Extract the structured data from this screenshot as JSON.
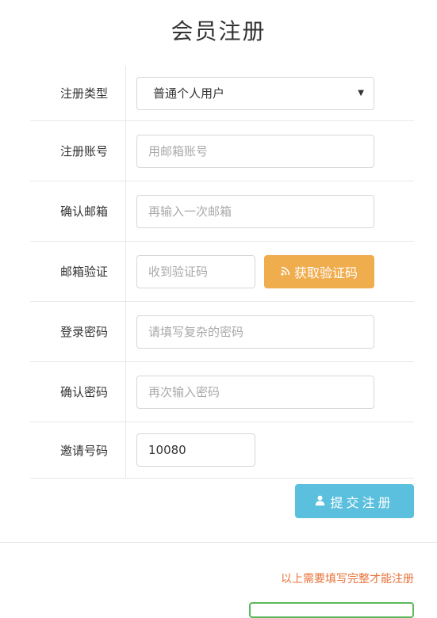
{
  "page": {
    "title": "会员注册"
  },
  "form": {
    "rows": [
      {
        "label": "注册类型",
        "type": "select",
        "value": "普通个人用户"
      },
      {
        "label": "注册账号",
        "type": "input",
        "placeholder": "用邮箱账号",
        "value": ""
      },
      {
        "label": "确认邮箱",
        "type": "input",
        "placeholder": "再输入一次邮箱",
        "value": ""
      },
      {
        "label": "邮箱验证",
        "type": "input",
        "placeholder": "收到验证码",
        "value": ""
      },
      {
        "label": "登录密码",
        "type": "input",
        "placeholder": "请填写复杂的密码",
        "value": ""
      },
      {
        "label": "确认密码",
        "type": "input",
        "placeholder": "再次输入密码",
        "value": ""
      },
      {
        "label": "邀请号码",
        "type": "input",
        "placeholder": "",
        "value": "10080"
      }
    ],
    "get_code_button": {
      "label": "获取验证码",
      "icon": "rss-icon"
    },
    "submit_button": {
      "label": "提交注册",
      "icon": "user-icon"
    }
  },
  "notice": "以上需要填写完整才能注册",
  "colors": {
    "code_button": "#f0ad4e",
    "submit_button": "#5bc0de",
    "notice": "#e8723a",
    "green_button_border": "#5cb85c"
  }
}
